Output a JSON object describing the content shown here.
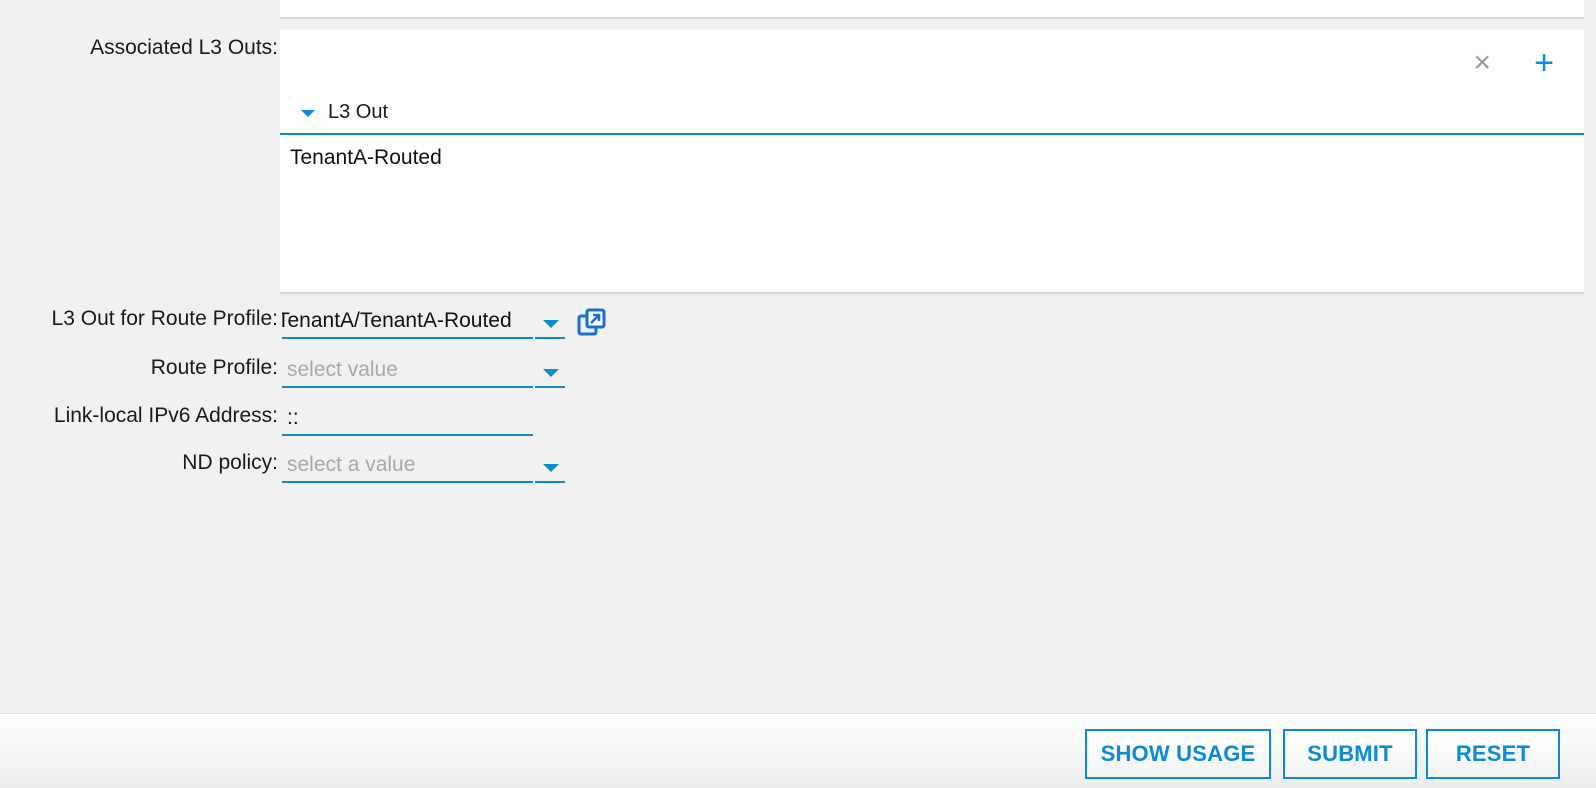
{
  "form": {
    "associated_l3_outs": {
      "label": "Associated L3 Outs:",
      "column_header": "L3 Out",
      "rows": [
        "TenantA-Routed"
      ],
      "delete_icon": "×",
      "add_icon": "+"
    },
    "l3_out_for_route_profile": {
      "label": "L3 Out for Route Profile:",
      "value": "TenantA/TenantA-Routed"
    },
    "route_profile": {
      "label": "Route Profile:",
      "placeholder": "select value"
    },
    "link_local_ipv6": {
      "label": "Link-local IPv6 Address:",
      "value": "::"
    },
    "nd_policy": {
      "label": "ND policy:",
      "placeholder": "select a value"
    }
  },
  "footer": {
    "show_usage_label": "SHOW USAGE",
    "submit_label": "SUBMIT",
    "reset_label": "RESET"
  },
  "colors": {
    "accent": "#0b8bd6",
    "background": "#f1f1f1",
    "placeholder": "#a9a9a9"
  },
  "icons": {
    "sort": "caret-down-icon",
    "dropdown": "chevron-down-icon",
    "open_external": "open-in-new-window-icon"
  }
}
